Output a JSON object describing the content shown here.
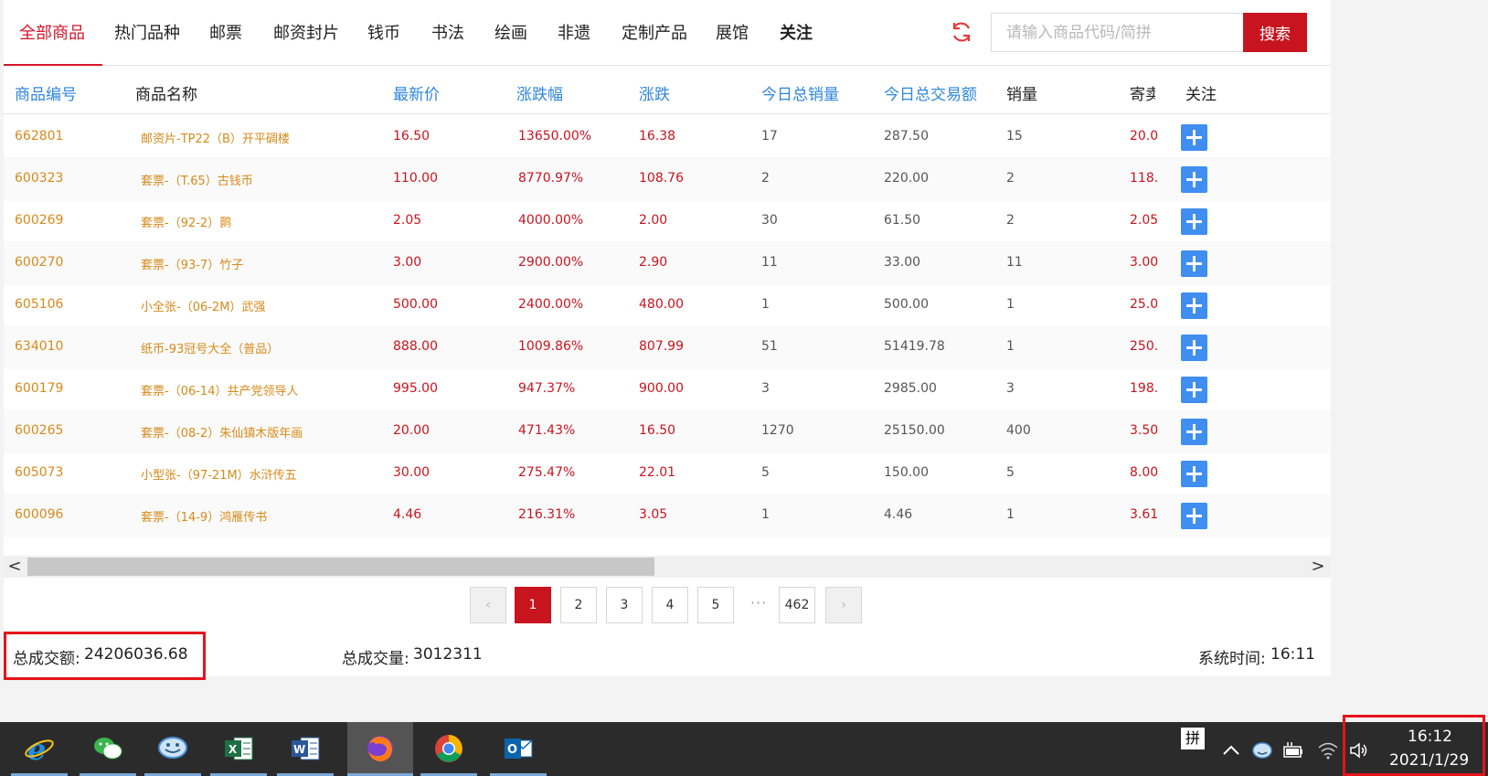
{
  "nav": {
    "tabs": [
      "全部商品",
      "热门品种",
      "邮票",
      "邮资封片",
      "钱币",
      "书法",
      "绘画",
      "非遗",
      "定制产品",
      "展馆",
      "关注"
    ],
    "active_index": 0
  },
  "search": {
    "placeholder": "请输入商品代码/简拼",
    "button_label": "搜索"
  },
  "table": {
    "headers": [
      "商品编号",
      "商品名称",
      "最新价",
      "涨跌幅",
      "涨跌",
      "今日总销量",
      "今日总交易额",
      "销量",
      "寄卖",
      "关注"
    ],
    "rows": [
      {
        "code": "662801",
        "name": "邮资片-TP22（B）开平碉楼",
        "price": "16.50",
        "pct": "13650.00%",
        "chg": "16.38",
        "vol": "17",
        "amt": "287.50",
        "sales": "15",
        "consign": "20.0"
      },
      {
        "code": "600323",
        "name": "套票-（T.65）古钱币",
        "price": "110.00",
        "pct": "8770.97%",
        "chg": "108.76",
        "vol": "2",
        "amt": "220.00",
        "sales": "2",
        "consign": "118."
      },
      {
        "code": "600269",
        "name": "套票-（92-2）鹮",
        "price": "2.05",
        "pct": "4000.00%",
        "chg": "2.00",
        "vol": "30",
        "amt": "61.50",
        "sales": "2",
        "consign": "2.05"
      },
      {
        "code": "600270",
        "name": "套票-（93-7）竹子",
        "price": "3.00",
        "pct": "2900.00%",
        "chg": "2.90",
        "vol": "11",
        "amt": "33.00",
        "sales": "11",
        "consign": "3.00"
      },
      {
        "code": "605106",
        "name": "小全张-（06-2M）武强",
        "price": "500.00",
        "pct": "2400.00%",
        "chg": "480.00",
        "vol": "1",
        "amt": "500.00",
        "sales": "1",
        "consign": "25.0"
      },
      {
        "code": "634010",
        "name": "纸币-93冠号大全（普品）",
        "price": "888.00",
        "pct": "1009.86%",
        "chg": "807.99",
        "vol": "51",
        "amt": "51419.78",
        "sales": "1",
        "consign": "250."
      },
      {
        "code": "600179",
        "name": "套票-（06-14）共产党领导人",
        "price": "995.00",
        "pct": "947.37%",
        "chg": "900.00",
        "vol": "3",
        "amt": "2985.00",
        "sales": "3",
        "consign": "198."
      },
      {
        "code": "600265",
        "name": "套票-（08-2）朱仙镇木版年画",
        "price": "20.00",
        "pct": "471.43%",
        "chg": "16.50",
        "vol": "1270",
        "amt": "25150.00",
        "sales": "400",
        "consign": "3.50"
      },
      {
        "code": "605073",
        "name": "小型张-（97-21M）水浒传五",
        "price": "30.00",
        "pct": "275.47%",
        "chg": "22.01",
        "vol": "5",
        "amt": "150.00",
        "sales": "5",
        "consign": "8.00"
      },
      {
        "code": "600096",
        "name": "套票-（14-9）鸿雁传书",
        "price": "4.46",
        "pct": "216.31%",
        "chg": "3.05",
        "vol": "1",
        "amt": "4.46",
        "sales": "1",
        "consign": "3.61"
      }
    ]
  },
  "scrollbar": {
    "left_arrow": "<",
    "right_arrow": ">"
  },
  "pagination": {
    "prev": "‹",
    "next": "›",
    "pages": [
      "1",
      "2",
      "3",
      "4",
      "5"
    ],
    "ellipsis": "···",
    "last": "462",
    "active": "1"
  },
  "summary": {
    "total_amount_label": "总成交额:",
    "total_amount": "24206036.68",
    "total_volume_label": "总成交量:",
    "total_volume": "3012311",
    "system_time_label": "系统时间:",
    "system_time": "16:11"
  },
  "taskbar": {
    "apps": [
      "ie-icon",
      "wechat-icon",
      "qq-icon",
      "excel-icon",
      "word-icon",
      "firefox-icon",
      "chrome-icon",
      "outlook-icon"
    ],
    "ime_label": "拼",
    "clock_time": "16:12",
    "clock_date": "2021/1/29"
  },
  "colors": {
    "accent_red": "#c8141f",
    "link_blue": "#2e86de",
    "code_orange": "#d78a1a",
    "plus_blue": "#3f8ef0"
  }
}
